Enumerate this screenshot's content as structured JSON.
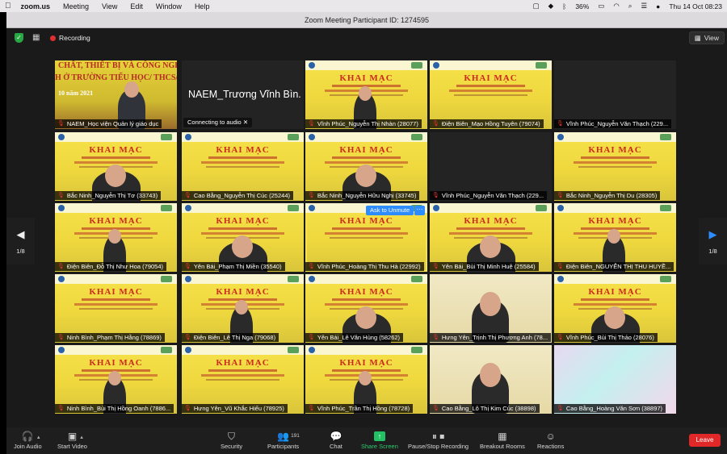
{
  "menubar": {
    "app_name": "zoom.us",
    "items": [
      "Meeting",
      "View",
      "Edit",
      "Window",
      "Help"
    ],
    "battery": "36%",
    "datetime": "Thu 14 Oct  08:23"
  },
  "window": {
    "title": "Zoom Meeting Participant ID: 1274595"
  },
  "topbar": {
    "recording_label": "Recording",
    "view_label": "View"
  },
  "tiles": [
    {
      "name": "NAEM_Học viện Quản lý giáo dục",
      "kind": "podium",
      "slide_line1": "CHẤT, THIẾT BỊ VÀ CÔNG NGHỆ",
      "slide_line2": "H Ở TRƯỜNG TIỂU HỌC/ THCS/ T",
      "slide_line3": "10 năm 2021"
    },
    {
      "name": "NAEM_Trương Vĩnh Bìn...",
      "kind": "dark",
      "status": "Connecting to audio"
    },
    {
      "name": "Vĩnh Phúc_Nguyễn Thị Nhàn (28077)",
      "kind": "slide"
    },
    {
      "name": "Điện Biên_Mạo Hồng Tuyên (79074)",
      "kind": "slide"
    },
    {
      "name": "Vĩnh Phúc_Nguyễn Văn Thạch (229...",
      "kind": "dark"
    },
    {
      "name": "Bắc Ninh_Nguyễn Thị Tơ (33743)",
      "kind": "slide"
    },
    {
      "name": "Cao Bằng_Nguyễn Thị Cúc (25244)",
      "kind": "slide"
    },
    {
      "name": "Bắc Ninh_Nguyễn Hữu Nghị (33745)",
      "kind": "slide"
    },
    {
      "name": "Vĩnh Phúc_Nguyễn Văn Thạch (229...",
      "kind": "dark"
    },
    {
      "name": "Bắc Ninh_Nguyễn Thị Du (28305)",
      "kind": "slide"
    },
    {
      "name": "Điện Biên_Đỗ Thị Như Hoa (79054)",
      "kind": "slide"
    },
    {
      "name": "Yên Bái_Phạm Thị Miền (35540)",
      "kind": "slide"
    },
    {
      "name": "Vĩnh Phúc_Hoàng Thị Thu Hà (22992)",
      "kind": "slide",
      "active": true
    },
    {
      "name": "Yên Bái_Bùi Thị Minh Huệ (25584)",
      "kind": "slide"
    },
    {
      "name": "Điện Biên_NGUYỄN THỊ THU HUYỀ...",
      "kind": "slide"
    },
    {
      "name": "Ninh Bình_Phạm Thị Hằng (78869)",
      "kind": "slide"
    },
    {
      "name": "Điện Biên_Lê Thị Nga (79068)",
      "kind": "slide"
    },
    {
      "name": "Yên Bái_Lê Văn Hùng (58262)",
      "kind": "slide"
    },
    {
      "name": "Hưng Yên_Trịnh Thị Phương Anh (78...",
      "kind": "room"
    },
    {
      "name": "Vĩnh Phúc_Bùi Thị Thảo (28076)",
      "kind": "slide"
    },
    {
      "name": "Ninh Bình_Bùi Thị Hồng Oanh (7886...",
      "kind": "slide"
    },
    {
      "name": "Hưng Yên_Vũ Khắc Hiếu (78925)",
      "kind": "slide"
    },
    {
      "name": "Vĩnh Phúc_Trần Thị Hồng (78728)",
      "kind": "slide"
    },
    {
      "name": "Cao Bằng_Lô Thị Kim Cúc (38898)",
      "kind": "room"
    },
    {
      "name": "Cao Bằng_Hoàng Văn Sơn (38897)",
      "kind": "pink"
    }
  ],
  "slide_heading": "KHAI MẠC",
  "slide_sub": "KHÓA BỒI DƯỠNG - TẬP HUẤN",
  "ask_to_unmute": "Ask to Unmute",
  "more_label": "···",
  "pager": {
    "left": "1/8",
    "right": "1/8"
  },
  "toolbar": {
    "join_audio": "Join Audio",
    "start_video": "Start Video",
    "security": "Security",
    "participants": "Participants",
    "participants_count": "191",
    "chat": "Chat",
    "share_screen": "Share Screen",
    "recording": "Pause/Stop Recording",
    "breakout": "Breakout Rooms",
    "reactions": "Reactions",
    "leave": "Leave"
  },
  "colors": {
    "accent": "#2d8cff",
    "leave": "#e02828",
    "share": "#23c163",
    "slide_yellow": "#f6e24b",
    "slide_red": "#cc2b1d"
  }
}
